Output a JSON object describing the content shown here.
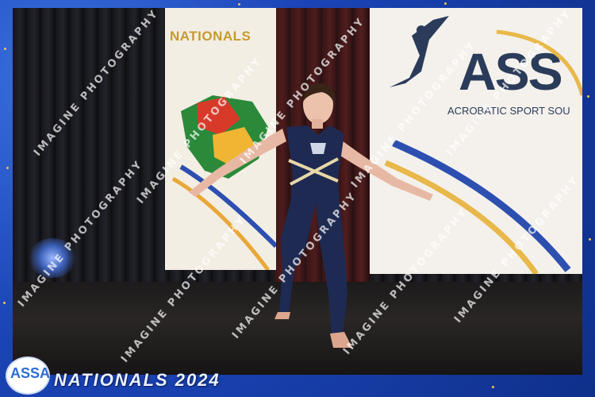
{
  "photo": {
    "banner_left": {
      "title": "NATIONALS"
    },
    "banner_right": {
      "logo_text": "ASS",
      "caption": "ACROBATIC SPORT SOU"
    }
  },
  "watermark": {
    "text": "IMAGINE PHOTOGRAPHY"
  },
  "footer": {
    "logo_text": "ASSA",
    "event_title": "NATIONALS 2024"
  },
  "colors": {
    "frame_blue": "#1b45b8",
    "gold_accent": "#f3c64a",
    "leotard_navy": "#1e2a52"
  }
}
